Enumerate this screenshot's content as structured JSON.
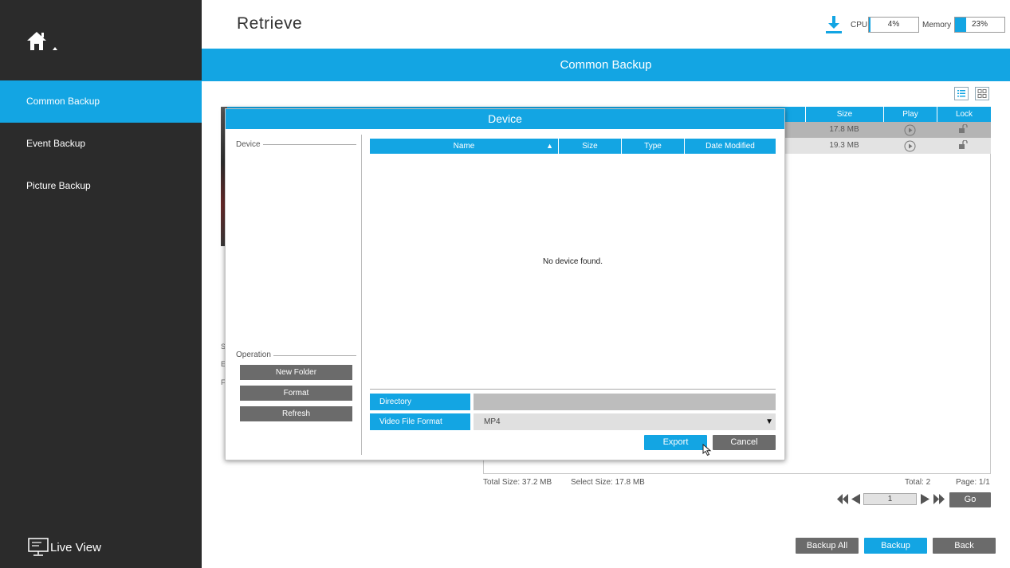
{
  "sidebar": {
    "items": [
      {
        "label": "Common Backup",
        "active": true
      },
      {
        "label": "Event Backup",
        "active": false
      },
      {
        "label": "Picture Backup",
        "active": false
      }
    ],
    "live_view_label": "Live View"
  },
  "header": {
    "title": "Retrieve",
    "cpu_label": "CPU",
    "cpu_value": "4%",
    "cpu_fraction": 0.04,
    "memory_label": "Memory",
    "memory_value": "23%",
    "memory_fraction": 0.23
  },
  "banner": {
    "title": "Common Backup"
  },
  "file_table": {
    "columns": [
      "Size",
      "Play",
      "Lock"
    ],
    "rows": [
      {
        "size": "17.8 MB",
        "selected": true
      },
      {
        "size": "19.3 MB",
        "selected": false
      }
    ],
    "side_cut_letters": [
      "S",
      "E",
      "F"
    ]
  },
  "footer": {
    "total_size": "Total Size: 37.2 MB",
    "select_size": "Select Size: 17.8 MB",
    "total_count": "Total: 2",
    "page": "Page: 1/1",
    "page_input": "1",
    "go_label": "Go",
    "backup_all_label": "Backup All",
    "backup_label": "Backup",
    "back_label": "Back"
  },
  "modal": {
    "title": "Device",
    "device_group_label": "Device",
    "operation_group_label": "Operation",
    "operations": [
      "New Folder",
      "Format",
      "Refresh"
    ],
    "columns": [
      "Name",
      "Size",
      "Type",
      "Date Modified"
    ],
    "sort_indicator": "▲",
    "empty_message": "No device found.",
    "directory_label": "Directory",
    "directory_value": "",
    "video_format_label": "Video File Format",
    "video_format_value": "MP4",
    "export_label": "Export",
    "cancel_label": "Cancel"
  },
  "colors": {
    "accent": "#13a5e3",
    "sidebar": "#2b2b2b",
    "button_gray": "#6b6b6b"
  }
}
